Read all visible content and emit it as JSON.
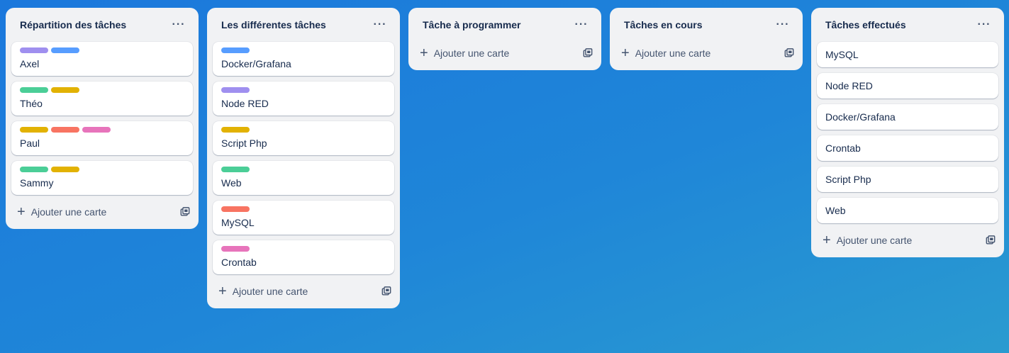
{
  "colors": {
    "purple": "#9f8fef",
    "blue": "#579dff",
    "green": "#4bce97",
    "yellow": "#e2b203",
    "red": "#f87462",
    "pink": "#e774bb"
  },
  "add_card_label": "Ajouter une carte",
  "lists": [
    {
      "title": "Répartition des tâches",
      "cards": [
        {
          "title": "Axel",
          "labels": [
            "purple",
            "blue"
          ]
        },
        {
          "title": "Théo",
          "labels": [
            "green",
            "yellow"
          ]
        },
        {
          "title": "Paul",
          "labels": [
            "yellow",
            "red",
            "pink"
          ]
        },
        {
          "title": "Sammy",
          "labels": [
            "green",
            "yellow"
          ]
        }
      ]
    },
    {
      "title": "Les différentes tâches",
      "cards": [
        {
          "title": "Docker/Grafana",
          "labels": [
            "blue"
          ]
        },
        {
          "title": "Node RED",
          "labels": [
            "purple"
          ]
        },
        {
          "title": "Script Php",
          "labels": [
            "yellow"
          ]
        },
        {
          "title": "Web",
          "labels": [
            "green"
          ]
        },
        {
          "title": "MySQL",
          "labels": [
            "red"
          ]
        },
        {
          "title": "Crontab",
          "labels": [
            "pink"
          ]
        }
      ]
    },
    {
      "title": "Tâche à programmer",
      "cards": []
    },
    {
      "title": "Tâches en cours",
      "cards": []
    },
    {
      "title": "Tâches effectués",
      "cards": [
        {
          "title": "MySQL",
          "labels": []
        },
        {
          "title": "Node RED",
          "labels": []
        },
        {
          "title": "Docker/Grafana",
          "labels": []
        },
        {
          "title": "Crontab",
          "labels": []
        },
        {
          "title": "Script Php",
          "labels": []
        },
        {
          "title": "Web",
          "labels": []
        }
      ]
    }
  ],
  "icons": {
    "more": "ellipsis-icon",
    "add": "plus-icon",
    "template": "card-template-icon"
  }
}
